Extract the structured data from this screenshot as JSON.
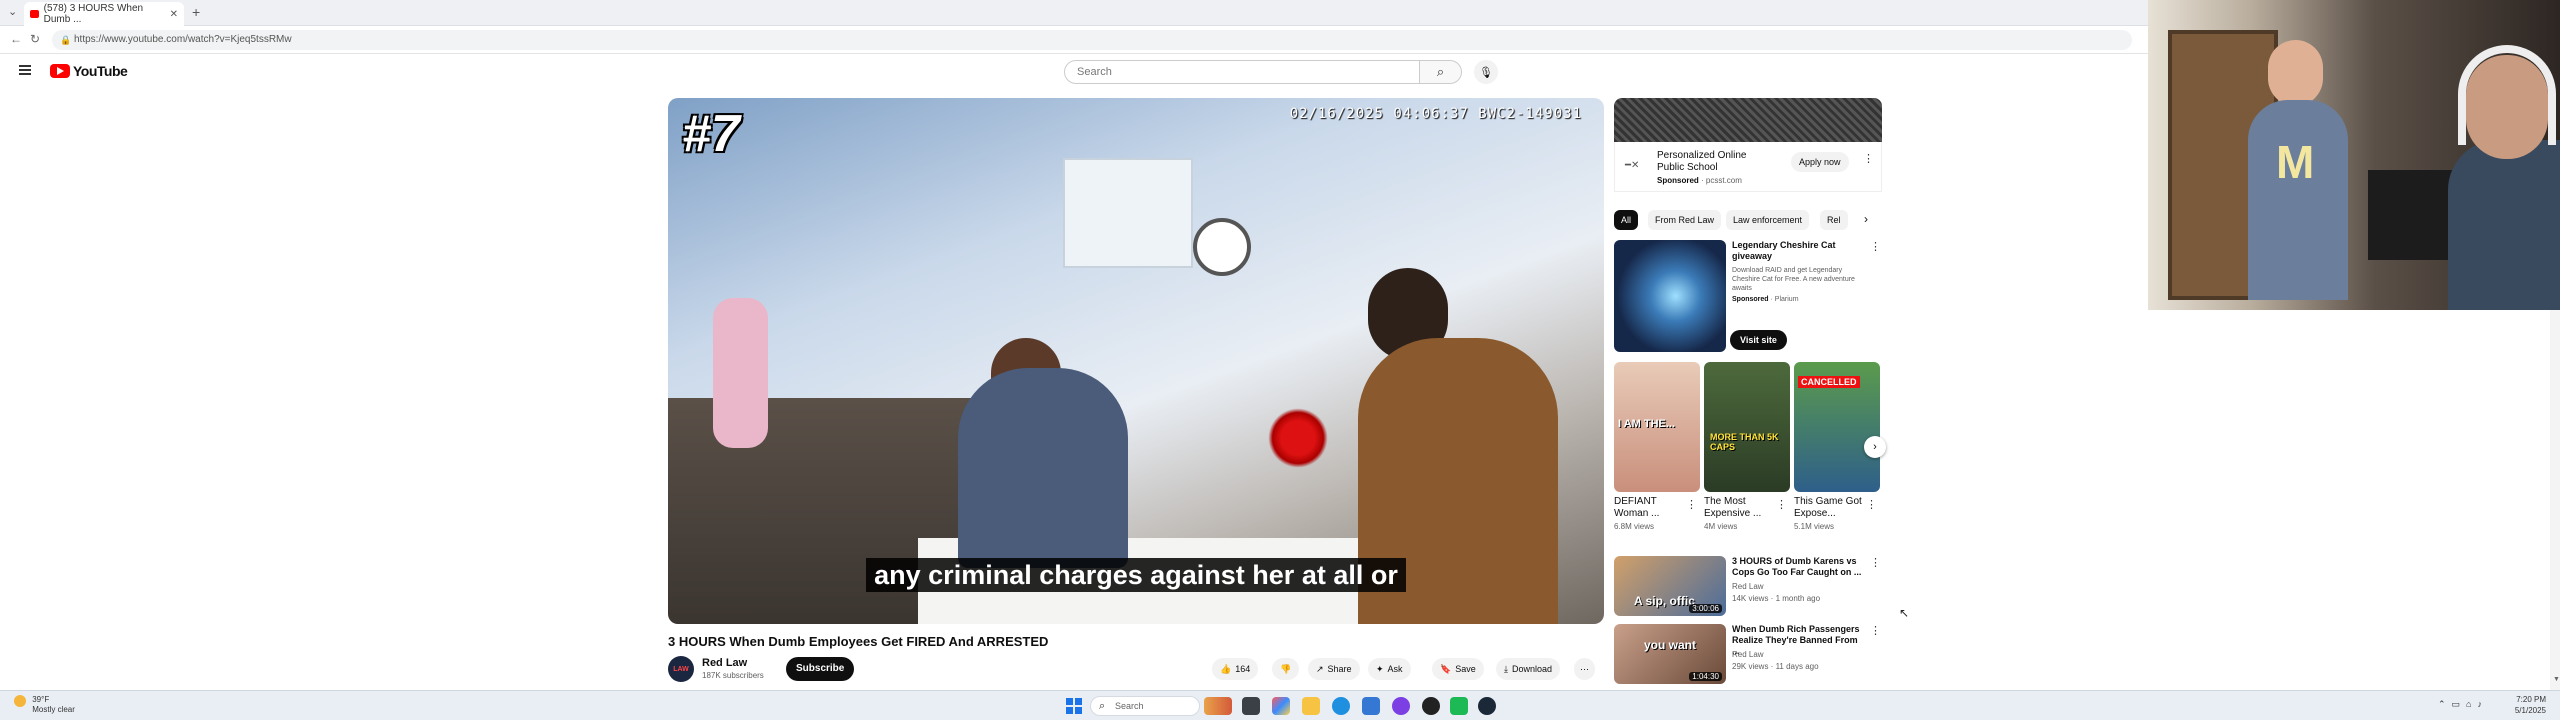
{
  "browser": {
    "tab_title": "(578) 3 HOURS When Dumb ...",
    "new_tab_label": "+",
    "url": "https://www.youtube.com/watch?v=Kjeq5tssRMw",
    "back_label": "←",
    "reload_label": "↻"
  },
  "youtube": {
    "logo_text": "YouTube",
    "search_placeholder": "Search",
    "search_icon": "search-icon",
    "mic_icon": "mic-icon"
  },
  "video": {
    "overlay_number": "#7",
    "timestamp": "02/16/2025 04:06:37 BWC2-149031",
    "caption": "any criminal charges against her at all or",
    "title": "3 HOURS When Dumb Employees Get FIRED And ARRESTED",
    "channel_name": "Red Law",
    "channel_avatar_text": "LAW",
    "subscribers": "187K subscribers",
    "subscribe_label": "Subscribe",
    "actions": {
      "like_count": "164",
      "share_label": "Share",
      "ask_label": "Ask",
      "save_label": "Save",
      "download_label": "Download",
      "more_label": "⋯"
    }
  },
  "sidebar": {
    "ad": {
      "title": "Personalized Online Public School",
      "sponsored_label": "Sponsored",
      "advertiser": "· pcsst.com",
      "cta_label": "Apply now"
    },
    "chips": [
      {
        "label": "All",
        "selected": true
      },
      {
        "label": "From Red Law",
        "selected": false
      },
      {
        "label": "Law enforcement",
        "selected": false
      },
      {
        "label": "Rel",
        "selected": false
      }
    ],
    "ad2": {
      "title": "Legendary Cheshire Cat giveaway",
      "description": "Download RAID and get Legendary Cheshire Cat for Free. A new adventure awaits",
      "sponsored_label": "Sponsored",
      "advertiser": "· Plarium",
      "cta_label": "Visit site"
    },
    "shorts": [
      {
        "title": "DEFIANT Woman ...",
        "views": "6.8M views",
        "thumb_text": "I AM THE..."
      },
      {
        "title": "The Most Expensive ...",
        "views": "4M views",
        "thumb_text": "MORE THAN 5K CAPS"
      },
      {
        "title": "This Game Got Expose...",
        "views": "5.1M views",
        "thumb_text": "CANCELLED"
      }
    ],
    "videos": [
      {
        "title": "3 HOURS of Dumb Karens vs Cops Go Too Far Caught on ...",
        "channel": "Red Law",
        "meta": "14K views · 1 month ago",
        "duration": "3:00:06",
        "thumb_text": "A sip, offic"
      },
      {
        "title": "When Dumb Rich Passengers Realize They're Banned From ...",
        "channel": "Red Law",
        "meta": "29K views · 11 days ago",
        "duration": "1:04:30",
        "thumb_text": "you want"
      }
    ]
  },
  "taskbar": {
    "weather_temp": "39°F",
    "weather_desc": "Mostly clear",
    "search_placeholder": "Search",
    "time": "7:20 PM",
    "date": "5/1/2025"
  }
}
